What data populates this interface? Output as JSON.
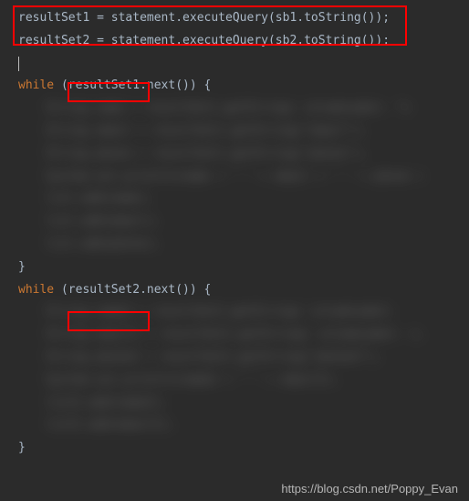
{
  "code": {
    "line1_var": "resultSet1",
    "line1_op": " = ",
    "line1_obj": "statement",
    "line1_dot": ".",
    "line1_method": "executeQuery",
    "line1_args_open": "(",
    "line1_arg_obj": "sb1",
    "line1_arg_dot": ".",
    "line1_arg_method": "toString",
    "line1_arg_parens": "()",
    "line1_close": ")",
    "line1_semi": ";",
    "line2_var": "resultSet2",
    "line2_op": " = ",
    "line2_obj": "statement",
    "line2_dot": ".",
    "line2_method": "executeQuery",
    "line2_args_open": "(",
    "line2_arg_obj": "sb2",
    "line2_arg_dot": ".",
    "line2_arg_method": "toString",
    "line2_arg_parens": "()",
    "line2_close": ")",
    "line2_semi": ";",
    "while_kw": "while",
    "while1_open": " (",
    "while1_var": "resultSet1",
    "while1_dot": ".",
    "while1_method": "next",
    "while1_parens": "()",
    "while1_close": ") {",
    "while2_open": " (",
    "while2_var": "resultSet2",
    "while2_dot": ".",
    "while2_method": "next",
    "while2_parens": "()",
    "while2_close": ") {",
    "close_brace": "}"
  },
  "watermark": "https://blog.csdn.net/Poppy_Evan"
}
